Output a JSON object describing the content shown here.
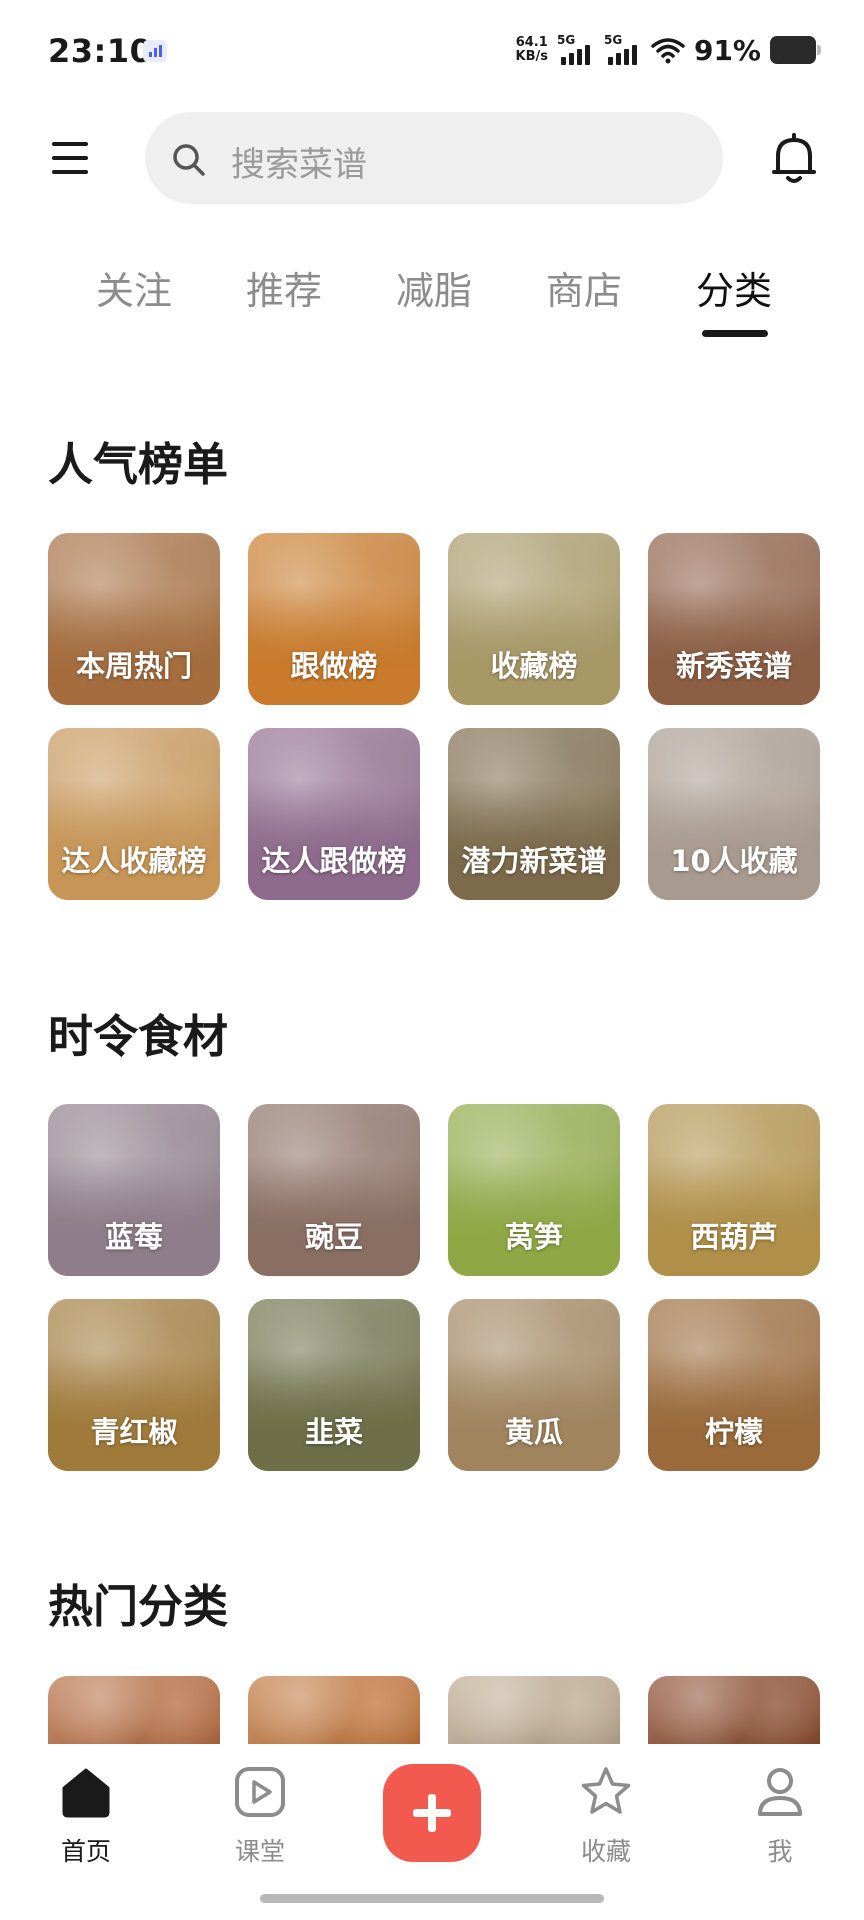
{
  "status_bar": {
    "time": "23:10",
    "net_speed_value": "64.1",
    "net_speed_unit": "KB/s",
    "sim1": "5G",
    "sim2": "5G",
    "battery": "91%"
  },
  "header": {
    "menu_icon": "hamburger-menu-icon",
    "search_placeholder": "搜索菜谱",
    "search_icon": "search-icon",
    "notification_icon": "bell-icon"
  },
  "tabs": [
    {
      "label": "关注",
      "active": false
    },
    {
      "label": "推荐",
      "active": false
    },
    {
      "label": "减脂",
      "active": false
    },
    {
      "label": "商店",
      "active": false
    },
    {
      "label": "分类",
      "active": true
    }
  ],
  "sections": [
    {
      "title": "人气榜单",
      "items": [
        {
          "label": "本周热门",
          "color": "#a56d3e"
        },
        {
          "label": "跟做榜",
          "color": "#c97a2a"
        },
        {
          "label": "收藏榜",
          "color": "#a89866"
        },
        {
          "label": "新秀菜谱",
          "color": "#8c5e44"
        },
        {
          "label": "达人收藏榜",
          "color": "#c79556"
        },
        {
          "label": "达人跟做榜",
          "color": "#8e6a8c"
        },
        {
          "label": "潜力新菜谱",
          "color": "#7c6a4a"
        },
        {
          "label": "10人收藏",
          "color": "#a89a8e"
        }
      ]
    },
    {
      "title": "时令食材",
      "items": [
        {
          "label": "蓝莓",
          "color": "#8e7d8a"
        },
        {
          "label": "豌豆",
          "color": "#8a6e62"
        },
        {
          "label": "莴笋",
          "color": "#8fa845"
        },
        {
          "label": "西葫芦",
          "color": "#b09048"
        },
        {
          "label": "青红椒",
          "color": "#a07a3a"
        },
        {
          "label": "韭菜",
          "color": "#6e6e48"
        },
        {
          "label": "黄瓜",
          "color": "#a0845e"
        },
        {
          "label": "柠檬",
          "color": "#9a6a3a"
        }
      ]
    },
    {
      "title": "热门分类",
      "items": [
        {
          "label": "",
          "color": "#b46a3e"
        },
        {
          "label": "",
          "color": "#c0743a"
        },
        {
          "label": "",
          "color": "#bca88c"
        },
        {
          "label": "",
          "color": "#8a4a2c"
        }
      ]
    }
  ],
  "bottom_nav": {
    "items": [
      {
        "label": "首页",
        "icon": "home-icon",
        "active": true
      },
      {
        "label": "课堂",
        "icon": "play-icon",
        "active": false
      },
      {
        "label": "收藏",
        "icon": "star-icon",
        "active": false
      },
      {
        "label": "我",
        "icon": "person-icon",
        "active": false
      }
    ],
    "add_icon": "plus-icon",
    "accent": "#f35a4f"
  }
}
